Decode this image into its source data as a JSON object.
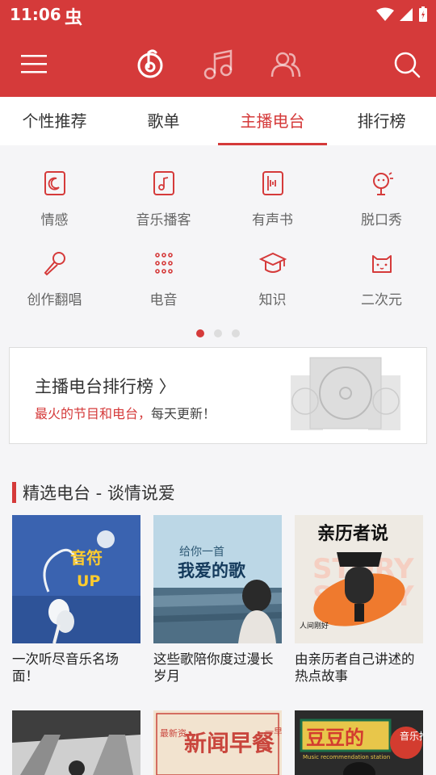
{
  "status": {
    "time": "11:06",
    "bug_glyph": "虫"
  },
  "appbar": {
    "menu_icon": "hamburger-menu-icon",
    "tab_icons": [
      "vinyl-note-icon",
      "music-note-icon",
      "friends-icon"
    ],
    "search_icon": "search-icon"
  },
  "tabs": [
    {
      "label": "个性推荐"
    },
    {
      "label": "歌单"
    },
    {
      "label": "主播电台",
      "active": true
    },
    {
      "label": "排行榜"
    }
  ],
  "categories": [
    {
      "label": "情感",
      "icon": "moon-card-icon"
    },
    {
      "label": "音乐播客",
      "icon": "music-card-icon"
    },
    {
      "label": "有声书",
      "icon": "book-icon"
    },
    {
      "label": "脱口秀",
      "icon": "microphone-face-icon"
    },
    {
      "label": "创作翻唱",
      "icon": "microphone-icon"
    },
    {
      "label": "电音",
      "icon": "dot-grid-icon"
    },
    {
      "label": "知识",
      "icon": "graduation-cap-icon"
    },
    {
      "label": "二次元",
      "icon": "cat-face-icon"
    }
  ],
  "pager": {
    "pages": 3,
    "current": 1
  },
  "rank_banner": {
    "title": "主播电台排行榜 〉",
    "subtitle_highlight": "最火的节目和电台，",
    "subtitle_rest": "每天更新！"
  },
  "section": {
    "title": "精选电台 - 谈情说爱"
  },
  "cards": [
    {
      "caption": "一次听尽音乐名场面！",
      "cover_text": [
        "音符",
        "UP"
      ],
      "bg": "#3a63b0"
    },
    {
      "caption": "这些歌陪你度过漫长岁月",
      "cover_text": [
        "给你一首",
        "我爱的歌"
      ],
      "bg": "#5a7e96"
    },
    {
      "caption": "由亲历者自己讲述的热点故事",
      "cover_text": [
        "亲历者说",
        "人间刚好"
      ],
      "bg": "#eeeae3"
    }
  ],
  "cards_row2": [
    {
      "cover_text": "",
      "bg": "#4a4a4a"
    },
    {
      "cover_text": "新闻早餐",
      "side_text": "一早知",
      "side_left": "最新资",
      "bg": "#f2e3cf"
    },
    {
      "cover_text": "豆豆的",
      "sub_text": "Music recommendation station",
      "side_text": "音乐推",
      "bg": "#2b2b2b"
    }
  ]
}
